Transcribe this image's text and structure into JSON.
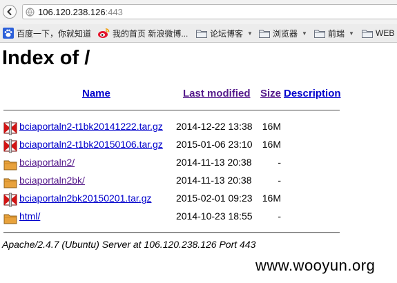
{
  "browser": {
    "url_host": "106.120.238.126",
    "url_port": ":443",
    "icons": {
      "back": "back-arrow-icon",
      "page": "page-icon"
    }
  },
  "bookmarks": [
    {
      "label": "百度一下，你就知道",
      "icon": "baidu-paw-icon"
    },
    {
      "label": "我的首页 新浪微博...",
      "icon": "weibo-icon"
    },
    {
      "label": "论坛博客",
      "icon": "folder-icon",
      "dropdown": true
    },
    {
      "label": "浏览器",
      "icon": "folder-icon",
      "dropdown": true
    },
    {
      "label": "前端",
      "icon": "folder-icon",
      "dropdown": true
    },
    {
      "label": "WEB",
      "icon": "folder-icon"
    }
  ],
  "page": {
    "title": "Index of /",
    "columns": {
      "name": "Name",
      "last_modified": "Last modified",
      "size": "Size",
      "description": "Description"
    },
    "entries": [
      {
        "name": "bciaportaln2-t1bk20141222.tar.gz",
        "modified": "2014-12-22 13:38",
        "size": "16M",
        "icon": "compressed-file-icon",
        "visited": false
      },
      {
        "name": "bciaportaln2-t1bk20150106.tar.gz",
        "modified": "2015-01-06 23:10",
        "size": "16M",
        "icon": "compressed-file-icon",
        "visited": false
      },
      {
        "name": "bciaportaln2/",
        "modified": "2014-11-13 20:38",
        "size": "-",
        "icon": "folder-icon",
        "visited": true
      },
      {
        "name": "bciaportaln2bk/",
        "modified": "2014-11-13 20:38",
        "size": "-",
        "icon": "folder-icon",
        "visited": true
      },
      {
        "name": "bciaportaln2bk20150201.tar.gz",
        "modified": "2015-02-01 09:23",
        "size": "16M",
        "icon": "compressed-file-icon",
        "visited": false
      },
      {
        "name": "html/",
        "modified": "2014-10-23 18:55",
        "size": "-",
        "icon": "folder-icon",
        "visited": false
      }
    ],
    "footer": "Apache/2.4.7 (Ubuntu) Server at 106.120.238.126 Port 443"
  },
  "watermark": "www.wooyun.org",
  "colors": {
    "link": "#0000cc",
    "visited": "#551a8b",
    "folder": "#e8a23c",
    "archive_red": "#d21414"
  }
}
